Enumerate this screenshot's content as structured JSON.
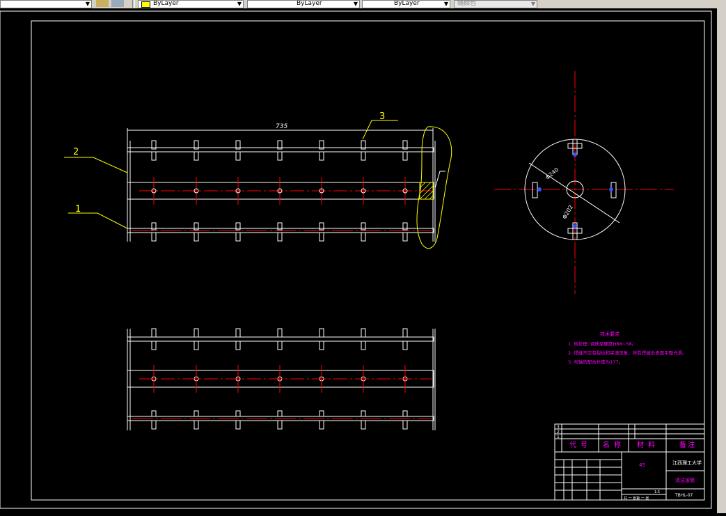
{
  "toolbar": {
    "layer_value": "ByLayer",
    "linetype_value": "ByLayer",
    "lineweight_value": "ByLayer",
    "plotstyle_value": "随颜色"
  },
  "colors": {
    "background": "#000000",
    "geometry": "#ffffff",
    "center_line": "#ff0000",
    "leader": "#ffff00",
    "hatch": "#ffff00",
    "notes": "#ff00ff",
    "title_block": "#ffffff"
  },
  "drawing": {
    "dimension_length": "735",
    "part_callouts": [
      "1",
      "2",
      "3"
    ],
    "dimension_diameter": "Φ240",
    "dimension_diameter2": "Φ202"
  },
  "notes": {
    "title": "技术要求",
    "items": [
      "1. 热处理: 调质至硬度HB8~58。",
      "2. 焊缝不应有裂纹和夹渣现象，所有焊缝处表面平整光滑。",
      "3. 与轴的配合长度为177。"
    ]
  },
  "title_block": {
    "rows": [
      "3",
      "2",
      "1"
    ],
    "headers": [
      "代号",
      "名称",
      "材料",
      "备注"
    ],
    "material": "45",
    "school": "江西理工大学",
    "part_name": "清洁滚筒",
    "drawing_no": "TBHL-07",
    "scale_label": "1:5",
    "sheet_text": "共 一 张第 一 张"
  }
}
